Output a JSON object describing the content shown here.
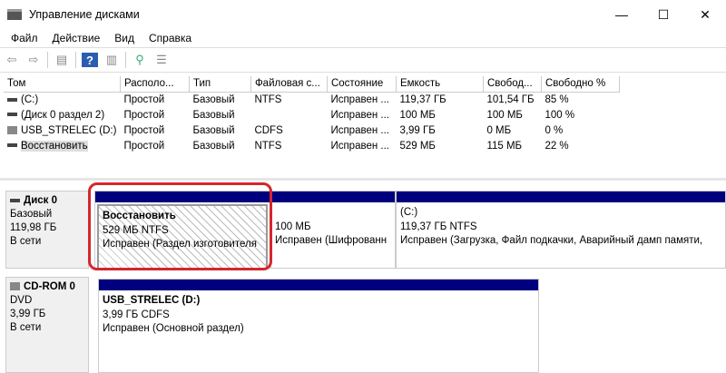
{
  "window": {
    "title": "Управление дисками"
  },
  "menu": [
    "Файл",
    "Действие",
    "Вид",
    "Справка"
  ],
  "columns": [
    "Том",
    "Располо...",
    "Тип",
    "Файловая с...",
    "Состояние",
    "Емкость",
    "Свобод...",
    "Свободно %"
  ],
  "rows": [
    [
      "(C:)",
      "Простой",
      "Базовый",
      "NTFS",
      "Исправен ...",
      "119,37 ГБ",
      "101,54 ГБ",
      "85 %"
    ],
    [
      "(Диск 0 раздел 2)",
      "Простой",
      "Базовый",
      "",
      "Исправен ...",
      "100 МБ",
      "100 МБ",
      "100 %"
    ],
    [
      "USB_STRELEC (D:)",
      "Простой",
      "Базовый",
      "CDFS",
      "Исправен ...",
      "3,99 ГБ",
      "0 МБ",
      "0 %"
    ],
    [
      "Восстановить",
      "Простой",
      "Базовый",
      "NTFS",
      "Исправен ...",
      "529 МБ",
      "115 МБ",
      "22 %"
    ]
  ],
  "disks": [
    {
      "name": "Диск 0",
      "type": "Базовый",
      "size": "119,98 ГБ",
      "status": "В сети",
      "partitions": [
        {
          "name": "Восстановить",
          "size": "529 МБ NTFS",
          "status": "Исправен (Раздел изготовителя"
        },
        {
          "name": "",
          "size": "100 МБ",
          "status": "Исправен (Шифрованн"
        },
        {
          "name": "(C:)",
          "size": "119,37 ГБ NTFS",
          "status": "Исправен (Загрузка, Файл подкачки, Аварийный дамп памяти,"
        }
      ]
    },
    {
      "name": "CD-ROM 0",
      "type": "DVD",
      "size": "3,99 ГБ",
      "status": "В сети",
      "partitions": [
        {
          "name": "USB_STRELEC  (D:)",
          "size": "3,99 ГБ CDFS",
          "status": "Исправен (Основной раздел)"
        }
      ]
    }
  ]
}
